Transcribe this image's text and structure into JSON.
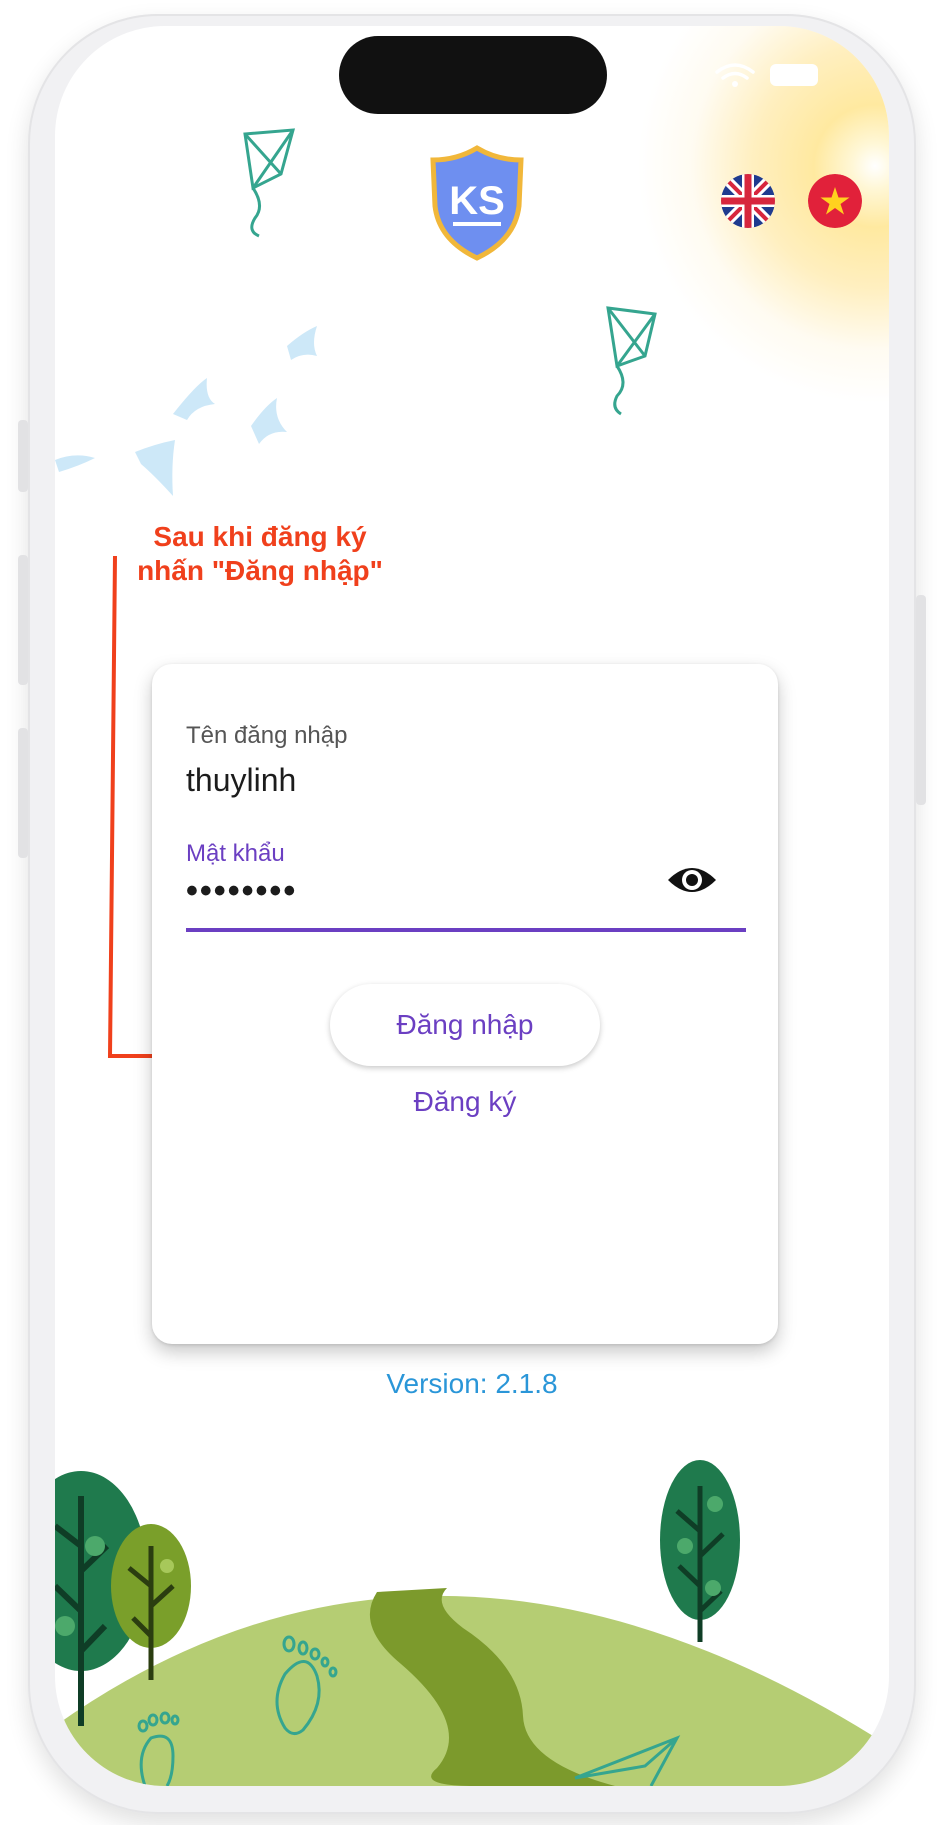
{
  "annotation": {
    "line1": "Sau khi đăng ký",
    "line2": "nhấn \"Đăng nhập\""
  },
  "login_form": {
    "username_label": "Tên đăng nhập",
    "username_value": "thuylinh",
    "password_label": "Mật khẩu",
    "password_value": "••••••••",
    "login_label": "Đăng nhập",
    "register_label": "Đăng ký"
  },
  "footer": {
    "version": "Version: 2.1.8"
  },
  "colors": {
    "accent": "#6b3fc2",
    "annotation": "#f0401c",
    "version": "#2a96d8",
    "hill": "#b5cd73",
    "path": "#7c9a2c"
  },
  "icons": {
    "logo": "ks-shield-logo",
    "lang_en": "uk-flag-icon",
    "lang_vi": "vietnam-flag-icon",
    "toggle_password": "eye-icon"
  }
}
